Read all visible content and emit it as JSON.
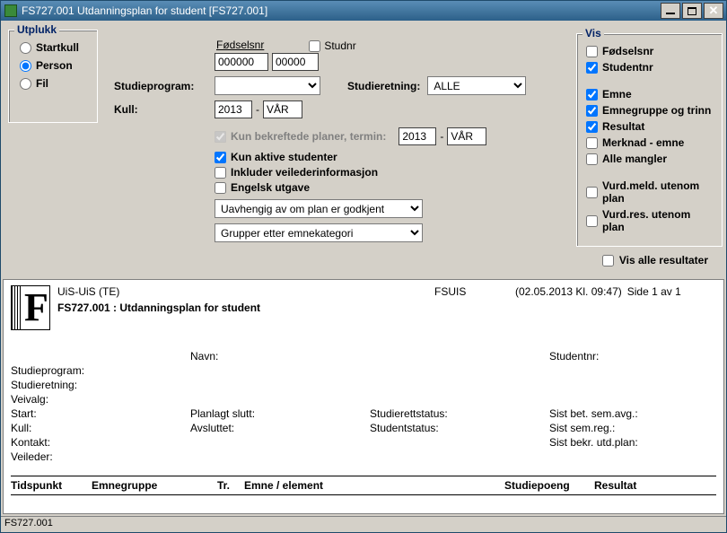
{
  "window": {
    "title": "FS727.001 Utdanningsplan for student [FS727.001]"
  },
  "utplukk": {
    "legend": "Utplukk",
    "options": {
      "startkull": "Startkull",
      "person": "Person",
      "fil": "Fil"
    },
    "selected": "Person"
  },
  "form": {
    "fodselsnr_label": "Fødselsnr",
    "studnr_label": "Studnr",
    "fodselsnr1": "000000",
    "fodselsnr2": "00000",
    "studieprogram_label": "Studieprogram:",
    "studieprogram_value": "",
    "studieretning_label": "Studieretning:",
    "studieretning_value": "ALLE",
    "kull_label": "Kull:",
    "kull_year": "2013",
    "kull_term": "VÅR",
    "bekreft_label": "Kun bekreftede planer, termin:",
    "bekreft_year": "2013",
    "bekreft_term": "VÅR",
    "chk_aktive": "Kun aktive studenter",
    "chk_veileder": "Inkluder veilederinformasjon",
    "chk_engelsk": "Engelsk utgave",
    "sel_godkjent": "Uavhengig av om plan er godkjent",
    "sel_gruppe": "Grupper etter emnekategori"
  },
  "vis": {
    "legend": "Vis",
    "fodselsnr": "Fødselsnr",
    "studentnr": "Studentnr",
    "emne": "Emne",
    "emnegruppe": "Emnegruppe og trinn",
    "resultat": "Resultat",
    "merknad": "Merknad - emne",
    "allemangler": "Alle mangler",
    "vurdmeld": "Vurd.meld. utenom plan",
    "vurdres": "Vurd.res. utenom plan",
    "alle_resultater": "Vis alle resultater"
  },
  "report": {
    "inst": "UiS-UiS  (TE)",
    "system": "FSUIS",
    "timestamp": "(02.05.2013 Kl. 09:47)",
    "page": "Side 1 av 1",
    "title": "FS727.001 : Utdanningsplan for student",
    "labels": {
      "navn": "Navn:",
      "studentnr": "Studentnr:",
      "studieprogram": "Studieprogram:",
      "studieretning": "Studieretning:",
      "veivalg": "Veivalg:",
      "start": "Start:",
      "kull": "Kull:",
      "kontakt": "Kontakt:",
      "veileder": "Veileder:",
      "planlagt_slutt": "Planlagt slutt:",
      "avsluttet": "Avsluttet:",
      "studierettstatus": "Studierettstatus:",
      "studentstatus": "Studentstatus:",
      "sist_bet": "Sist bet. sem.avg.:",
      "sist_reg": "Sist sem.reg.:",
      "sist_bekr": "Sist bekr. utd.plan:"
    },
    "columns": {
      "tidspunkt": "Tidspunkt",
      "emnegruppe": "Emnegruppe",
      "tr": "Tr.",
      "emne": "Emne / element",
      "studiepoeng": "Studiepoeng",
      "resultat": "Resultat"
    }
  },
  "statusbar": "FS727.001"
}
